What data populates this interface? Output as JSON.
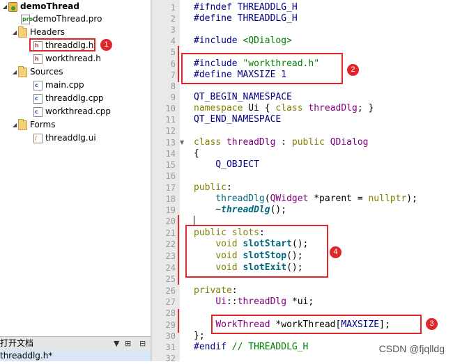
{
  "project": {
    "name": "demoThread",
    "pro_file": "demoThread.pro",
    "headers_label": "Headers",
    "headers": [
      "threaddlg.h",
      "workthread.h"
    ],
    "sources_label": "Sources",
    "sources": [
      "main.cpp",
      "threaddlg.cpp",
      "workthread.cpp"
    ],
    "forms_label": "Forms",
    "forms": [
      "threaddlg.ui"
    ]
  },
  "open_docs": {
    "title": "打开文档",
    "filter_icon": "split-icon",
    "active": "threaddlg.h*"
  },
  "badges": [
    "1",
    "2",
    "3",
    "4"
  ],
  "editor": {
    "line_numbers": [
      "1",
      "2",
      "3",
      "4",
      "5",
      "6",
      "7",
      "8",
      "9",
      "10",
      "11",
      "12",
      "13",
      "14",
      "15",
      "16",
      "17",
      "18",
      "19",
      "20",
      "21",
      "22",
      "23",
      "24",
      "25",
      "26",
      "27",
      "28",
      "29",
      "30",
      "31",
      "32"
    ],
    "lines": {
      "l1a": "#ifndef ",
      "l1b": "THREADDLG_H",
      "l2a": "#define ",
      "l2b": "THREADDLG_H",
      "l4a": "#include ",
      "l4b": "<QDialog>",
      "l6a": "#include ",
      "l6b": "\"workthread.h\"",
      "l7a": "#define ",
      "l7b": "MAXSIZE 1",
      "l9": "QT_BEGIN_NAMESPACE",
      "l10a": "namespace",
      "l10b": " Ui { ",
      "l10c": "class",
      "l10d": " ",
      "l10e": "threadDlg",
      "l10f": "; }",
      "l11": "QT_END_NAMESPACE",
      "l13a": "class",
      "l13b": " ",
      "l13c": "threadDlg",
      "l13d": " : ",
      "l13e": "public",
      "l13f": " ",
      "l13g": "QDialog",
      "l14": "{",
      "l15": "    Q_OBJECT",
      "l17a": "public",
      "l17b": ":",
      "l18a": "    ",
      "l18b": "threadDlg",
      "l18c": "(",
      "l18d": "QWidget",
      "l18e": " *parent = ",
      "l18f": "nullptr",
      "l18g": ");",
      "l19a": "    ~",
      "l19b": "threadDlg",
      "l19c": "();",
      "l21a": "public",
      "l21b": " ",
      "l21c": "slots",
      "l21d": ":",
      "l22a": "    ",
      "l22b": "void",
      "l22c": " ",
      "l22d": "slotStart",
      "l22e": "();",
      "l23a": "    ",
      "l23b": "void",
      "l23c": " ",
      "l23d": "slotStop",
      "l23e": "();",
      "l24a": "    ",
      "l24b": "void",
      "l24c": " ",
      "l24d": "slotExit",
      "l24e": "();",
      "l26a": "private",
      "l26b": ":",
      "l27a": "    ",
      "l27b": "Ui",
      "l27c": "::",
      "l27d": "threadDlg",
      "l27e": " *ui;",
      "l29a": "    ",
      "l29b": "WorkThread",
      "l29c": " *workThread[",
      "l29d": "MAXSIZE",
      "l29e": "];",
      "l30": "};",
      "l31a": "#endif ",
      "l31b": "// THREADDLG_H"
    }
  },
  "watermark": "CSDN @fjqlldg"
}
